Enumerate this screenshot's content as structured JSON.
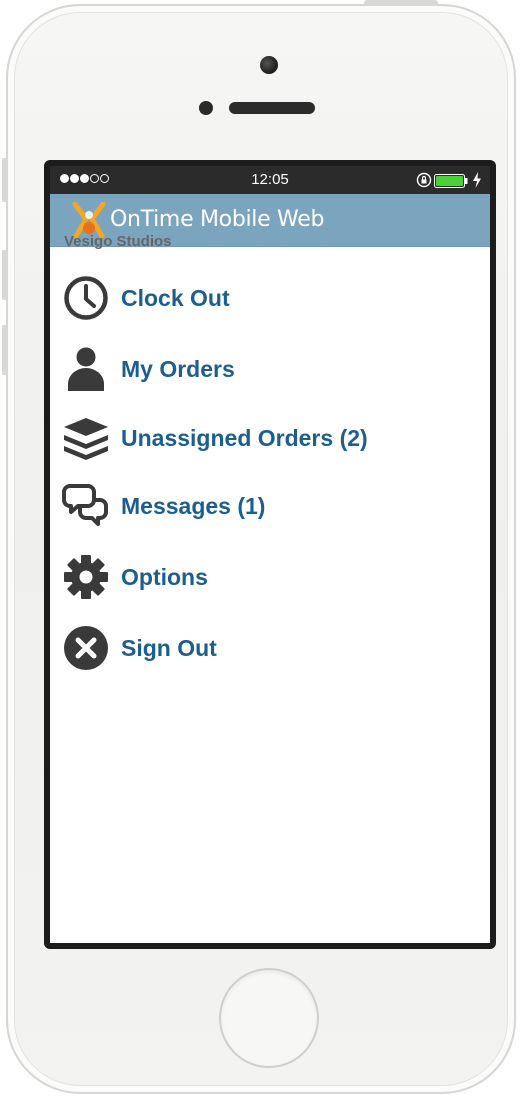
{
  "status_bar": {
    "time": "12:05",
    "signal_bars_filled": 3,
    "signal_bars_total": 5,
    "battery_level": 1.0,
    "battery_color": "#4cd038"
  },
  "app": {
    "title": "OnTime Mobile Web",
    "header_color": "#7ba5bf",
    "logo_colors": [
      "#f5a623",
      "#e8701a"
    ]
  },
  "company_name": "Vesigo Studios",
  "menu": {
    "label_color": "#1c5f8e",
    "icon_color": "#3a3a3a",
    "items": [
      {
        "label": "Clock Out",
        "icon": "clock-icon"
      },
      {
        "label": "My Orders",
        "icon": "person-icon"
      },
      {
        "label": "Unassigned Orders (2)",
        "icon": "layers-icon"
      },
      {
        "label": "Messages (1)",
        "icon": "chat-bubbles-icon"
      },
      {
        "label": "Options",
        "icon": "gear-icon"
      },
      {
        "label": "Sign Out",
        "icon": "close-circle-icon"
      }
    ]
  }
}
